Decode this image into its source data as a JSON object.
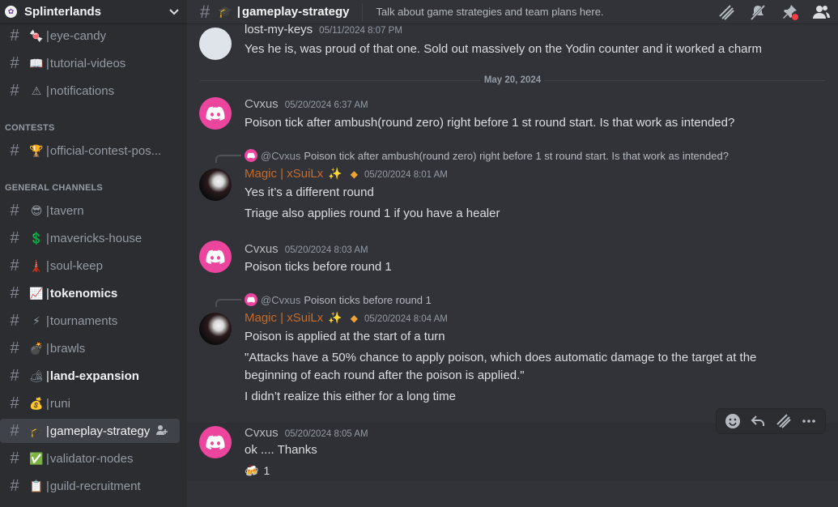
{
  "server": {
    "name": "Splinterlands",
    "icon": "splinterlands-logo-icon"
  },
  "sidebar": {
    "channels": [
      {
        "emoji": "🍬",
        "label": "eye-candy"
      },
      {
        "emoji": "📖",
        "label": "tutorial-videos"
      },
      {
        "emoji": "⚠",
        "label": "notifications"
      },
      {
        "emoji": "🏆",
        "label": "official-contest-pos..."
      },
      {
        "emoji": "😎",
        "label": "tavern"
      },
      {
        "emoji": "💲",
        "label": "mavericks-house"
      },
      {
        "emoji": "🗼",
        "label": "soul-keep"
      },
      {
        "emoji": "📈",
        "label": "tokenomics"
      },
      {
        "emoji": "⚡",
        "label": "tournaments"
      },
      {
        "emoji": "💣",
        "label": "brawls"
      },
      {
        "emoji": "🏕",
        "label": "land-expansion"
      },
      {
        "emoji": "💰",
        "label": "runi"
      },
      {
        "emoji": "🎓",
        "label": "gameplay-strategy"
      },
      {
        "emoji": "✅",
        "label": "validator-nodes"
      },
      {
        "emoji": "📋",
        "label": "guild-recruitment"
      }
    ],
    "categories": {
      "contests": "CONTESTS",
      "general": "GENERAL CHANNELS"
    }
  },
  "header": {
    "channel_emoji": "🎓",
    "channel_name": "gameplay-strategy",
    "topic": "Talk about game strategies and team plans here."
  },
  "messages": {
    "prev": {
      "author": "lost-my-keys",
      "timestamp": "05/11/2024 8:07 PM",
      "text": "Yes he is, was proud of that one. Sold out massively on the Yodin counter and it worked a charm"
    },
    "date_divider": "May 20, 2024",
    "m1": {
      "author": "Cvxus",
      "timestamp": "05/20/2024 6:37 AM",
      "text": "Poison tick after ambush(round zero) right before 1 st round start. Is that work as intended?"
    },
    "m2": {
      "reply_to": "@Cvxus",
      "reply_text": "Poison tick after ambush(round zero) right before 1 st round start. Is that work as intended?",
      "author": "Magic | xSuiLx",
      "sparkle": "✨",
      "diamond": "◆",
      "timestamp": "05/20/2024 8:01 AM",
      "line1": "Yes it’s a different round",
      "line2": "Triage also applies round 1 if you have a healer"
    },
    "m3": {
      "author": "Cvxus",
      "timestamp": "05/20/2024 8:03 AM",
      "text": "Poison ticks before round 1"
    },
    "m4": {
      "reply_to": "@Cvxus",
      "reply_text": "Poison ticks before round 1",
      "author": "Magic | xSuiLx",
      "sparkle": "✨",
      "diamond": "◆",
      "timestamp": "05/20/2024 8:04 AM",
      "line1": "Poison is applied at the start of a turn",
      "line2": "\"Attacks have a 50% chance to apply poison, which does automatic damage to the target at the",
      "line3": "beginning of each round after the poison is applied.\"",
      "line4": "I didn’t realize this either for a long time"
    },
    "m5": {
      "author": "Cvxus",
      "timestamp": "05/20/2024 8:05 AM",
      "text": "ok .... Thanks",
      "reaction_emoji": "🍻",
      "reaction_count": "1"
    }
  },
  "colors": {
    "accent_pink": "#eb459e",
    "magic_name": "#c46b2d",
    "diamond": "#f0a232"
  }
}
